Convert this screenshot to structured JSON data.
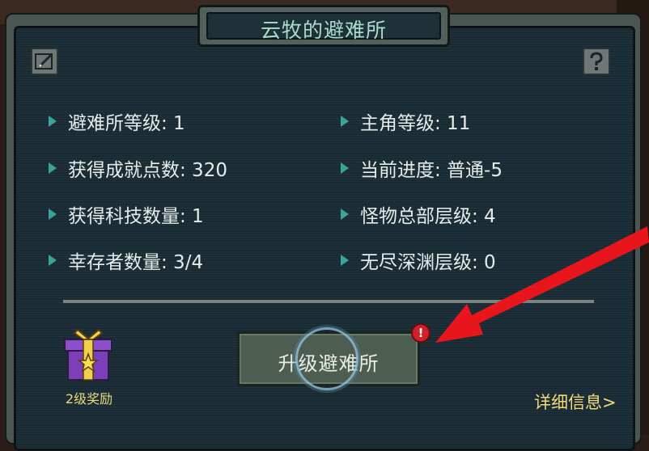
{
  "panel": {
    "title": "云牧的避难所",
    "stats_left": [
      {
        "label": "避难所等级: 1"
      },
      {
        "label": "获得成就点数: 320"
      },
      {
        "label": "获得科技数量: 1"
      },
      {
        "label": "幸存者数量: 3/4"
      }
    ],
    "stats_right": [
      {
        "label": "主角等级: 11"
      },
      {
        "label": "当前进度: 普通-5"
      },
      {
        "label": "怪物总部层级: 4"
      },
      {
        "label": "无尽深渊层级: 0"
      }
    ],
    "upgrade_button": {
      "label": "升级避难所",
      "alert_badge": "!"
    },
    "reward": {
      "label": "2级奖励",
      "icon": "gift-box-icon"
    },
    "details_link": "详细信息>",
    "icons": {
      "edit": "edit-icon",
      "help": "help-icon"
    }
  },
  "colors": {
    "panel_bg": "#182a33",
    "title_text": "#a9dcc9",
    "stat_bullet": "#3aa39a",
    "link_gold": "#efd97a",
    "alert_red": "#d0202a",
    "arrow_red": "#e8161c"
  }
}
